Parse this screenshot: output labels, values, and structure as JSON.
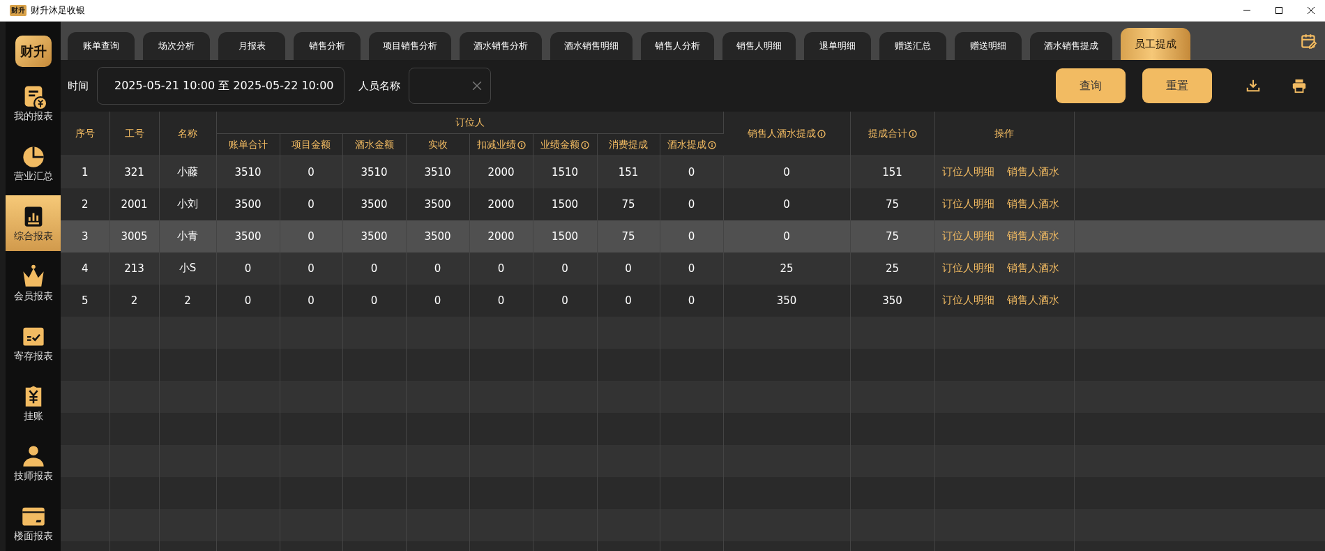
{
  "window": {
    "icon_text": "财升",
    "title": "财升沐足收银"
  },
  "sidebar": {
    "logo": "财升",
    "items": [
      {
        "label": "我的报表",
        "selected": false
      },
      {
        "label": "营业汇总",
        "selected": false
      },
      {
        "label": "综合报表",
        "selected": true
      },
      {
        "label": "会员报表",
        "selected": false
      },
      {
        "label": "寄存报表",
        "selected": false
      },
      {
        "label": "挂账",
        "selected": false
      },
      {
        "label": "技师报表",
        "selected": false
      },
      {
        "label": "楼面报表",
        "selected": false
      }
    ]
  },
  "tabs": [
    {
      "label": "账单查询",
      "selected": false
    },
    {
      "label": "场次分析",
      "selected": false
    },
    {
      "label": "月报表",
      "selected": false
    },
    {
      "label": "销售分析",
      "selected": false
    },
    {
      "label": "项目销售分析",
      "selected": false
    },
    {
      "label": "酒水销售分析",
      "selected": false
    },
    {
      "label": "酒水销售明细",
      "selected": false
    },
    {
      "label": "销售人分析",
      "selected": false
    },
    {
      "label": "销售人明细",
      "selected": false
    },
    {
      "label": "退单明细",
      "selected": false
    },
    {
      "label": "赠送汇总",
      "selected": false
    },
    {
      "label": "赠送明细",
      "selected": false
    },
    {
      "label": "酒水销售提成",
      "selected": false
    },
    {
      "label": "员工提成",
      "selected": true
    }
  ],
  "filters": {
    "time_label": "时间",
    "time_value": "2025-05-21 10:00 至 2025-05-22 10:00",
    "name_label": "人员名称",
    "buttons": [
      "查询",
      "重置"
    ]
  },
  "table": {
    "columns": [
      {
        "label": "序号"
      },
      {
        "label": "工号"
      },
      {
        "label": "名称"
      },
      {
        "label": "订位人",
        "colspan": 8,
        "columns": [
          {
            "label": "账单合计"
          },
          {
            "label": "项目金额"
          },
          {
            "label": "酒水金额"
          },
          {
            "label": "实收"
          },
          {
            "label": "扣减业绩",
            "info": true
          },
          {
            "label": "业绩金额",
            "info": true
          },
          {
            "label": "消费提成"
          },
          {
            "label": "酒水提成",
            "info": true
          }
        ]
      },
      {
        "label": "销售人酒水提成",
        "info": true
      },
      {
        "label": "提成合计",
        "info": true
      },
      {
        "label": "操作"
      }
    ],
    "rows": [
      {
        "selected": false,
        "cells": [
          "1",
          "321",
          "小藤",
          "3510",
          "0",
          "3510",
          "3510",
          "2000",
          "1510",
          "151",
          "0",
          "0",
          "151"
        ],
        "actions": [
          "订位人明细",
          "销售人酒水"
        ]
      },
      {
        "selected": false,
        "cells": [
          "2",
          "2001",
          "小刘",
          "3500",
          "0",
          "3500",
          "3500",
          "2000",
          "1500",
          "75",
          "0",
          "0",
          "75"
        ],
        "actions": [
          "订位人明细",
          "销售人酒水"
        ]
      },
      {
        "selected": true,
        "cells": [
          "3",
          "3005",
          "小青",
          "3500",
          "0",
          "3500",
          "3500",
          "2000",
          "1500",
          "75",
          "0",
          "0",
          "75"
        ],
        "actions": [
          "订位人明细",
          "销售人酒水"
        ]
      },
      {
        "selected": false,
        "cells": [
          "4",
          "213",
          "小S",
          "0",
          "0",
          "0",
          "0",
          "0",
          "0",
          "0",
          "0",
          "25",
          "25"
        ],
        "actions": [
          "订位人明细",
          "销售人酒水"
        ]
      },
      {
        "selected": false,
        "cells": [
          "5",
          "2",
          "2",
          "0",
          "0",
          "0",
          "0",
          "0",
          "0",
          "0",
          "0",
          "350",
          "350"
        ],
        "actions": [
          "订位人明细",
          "销售人酒水"
        ]
      }
    ]
  }
}
